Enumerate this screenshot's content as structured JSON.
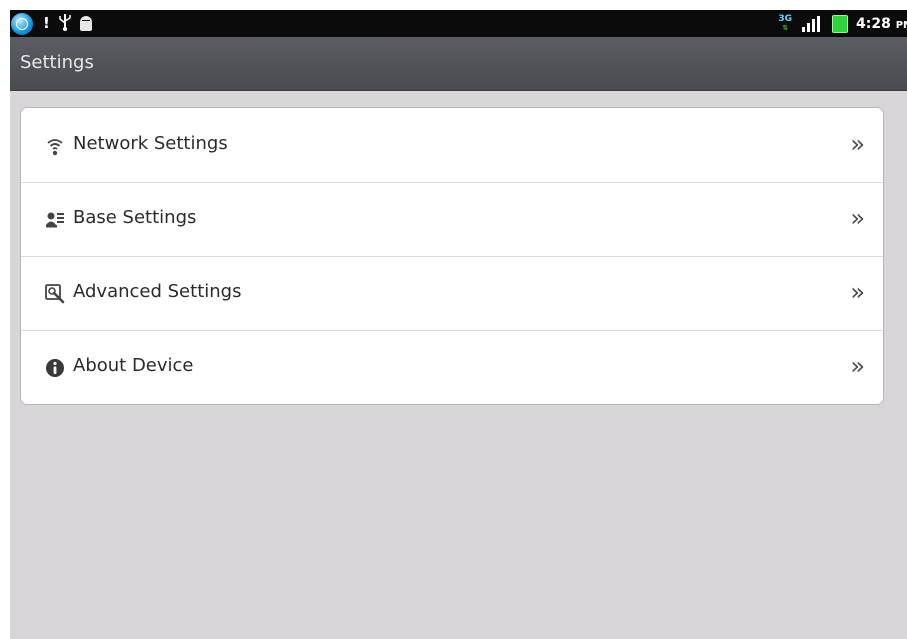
{
  "status_bar": {
    "left_icons": [
      "globe-icon",
      "alert-icon",
      "usb-icon",
      "android-debug-icon"
    ],
    "alert_glyph": "!",
    "usb_glyph": "⚲",
    "network_type": "3G",
    "clock": "4:28",
    "clock_suffix": "PM"
  },
  "header": {
    "title": "Settings"
  },
  "settings": {
    "items": [
      {
        "label": "Network Settings",
        "icon": "wifi-icon"
      },
      {
        "label": "Base Settings",
        "icon": "base-settings-icon"
      },
      {
        "label": "Advanced Settings",
        "icon": "advanced-settings-icon"
      },
      {
        "label": "About Device",
        "icon": "info-icon"
      }
    ],
    "chevron": "»"
  },
  "colors": {
    "status_bar_bg": "#0b0b0b",
    "title_bar_bg": "#505357",
    "content_bg": "#d9d6da",
    "card_bg": "#ffffff",
    "battery": "#2fd23a",
    "globe_accent": "#1a9be0"
  }
}
